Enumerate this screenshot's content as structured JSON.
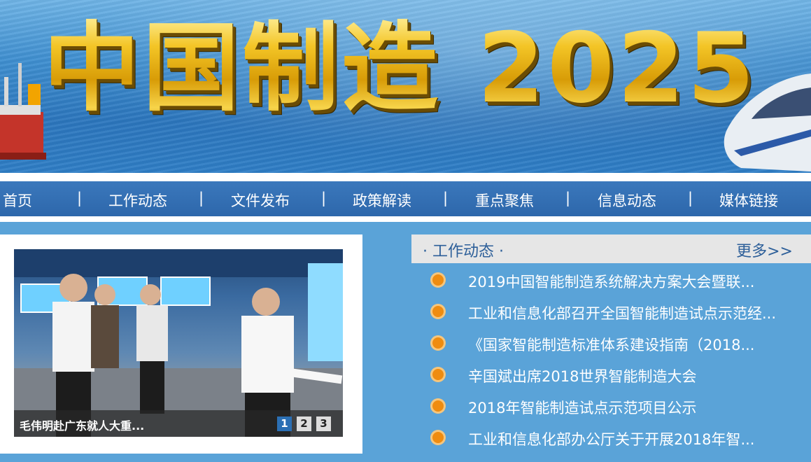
{
  "banner": {
    "title": "中国制造 2025"
  },
  "nav": {
    "items": [
      "首页",
      "工作动态",
      "文件发布",
      "政策解读",
      "重点聚焦",
      "信息动态",
      "媒体链接"
    ],
    "separator": "|"
  },
  "slider": {
    "caption": "毛伟明赴广东就人大重...",
    "pages": [
      "1",
      "2",
      "3"
    ],
    "active_page": 1
  },
  "news": {
    "title": "· 工作动态 ·",
    "more": "更多>>",
    "items": [
      "2019中国智能制造系统解决方案大会暨联...",
      "工业和信息化部召开全国智能制造试点示范经...",
      "《国家智能制造标准体系建设指南（2018...",
      "辛国斌出席2018世界智能制造大会",
      "2018年智能制造试点示范项目公示",
      "工业和信息化部办公厅关于开展2018年智..."
    ]
  },
  "colors": {
    "nav_bg": "#2d67ab",
    "content_bg": "#5aa3d8",
    "bullet": "#ef8c10",
    "news_title": "#2d5f99"
  }
}
